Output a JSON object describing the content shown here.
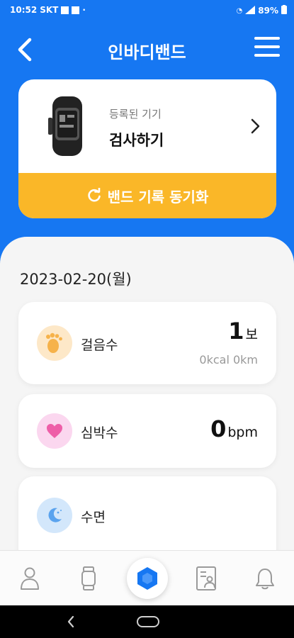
{
  "status_bar": {
    "time": "10:52",
    "carrier": "SKT",
    "battery": "89%"
  },
  "header": {
    "title": "인바디밴드"
  },
  "device": {
    "subtitle": "등록된 기기",
    "name": "검사하기"
  },
  "sync_button": {
    "label": "밴드 기록 동기화"
  },
  "date": "2023-02-20(월)",
  "metrics": [
    {
      "label": "걸음수",
      "value": "1",
      "unit": "보",
      "sub": "0kcal 0km",
      "icon": "footprint-icon",
      "icon_bg": "#fde8c8",
      "icon_color": "#f6b24a"
    },
    {
      "label": "심박수",
      "value": "0",
      "unit": "bpm",
      "icon": "heart-icon",
      "icon_bg": "#fbd7ef",
      "icon_color": "#ee5ea8"
    },
    {
      "label": "수면",
      "icon": "moon-icon",
      "icon_bg": "#d3e7fb",
      "icon_color": "#5aa3ee"
    }
  ],
  "colors": {
    "primary": "#1677f2",
    "sync": "#fab728"
  }
}
